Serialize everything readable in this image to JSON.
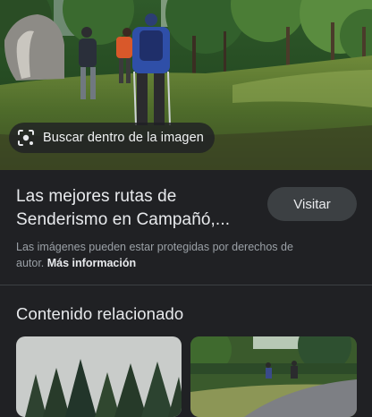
{
  "hero": {
    "image_alt": "Senderistas caminando por un prado junto a un bosque de pinos",
    "lens_chip_label": "Buscar dentro de la imagen",
    "lens_icon": "lens-scan-icon"
  },
  "result": {
    "title": "Las mejores rutas de Senderismo en Campañó,...",
    "visit_label": "Visitar",
    "disclaimer": "Las imágenes pueden estar protegidas por derechos de autor.",
    "more_info_label": "Más información"
  },
  "related": {
    "heading": "Contenido relacionado",
    "thumbnails": [
      {
        "alt": "Bosque de pinos bajo cielo gris"
      },
      {
        "alt": "Senderistas en un camino de bosque"
      }
    ]
  },
  "colors": {
    "background": "#202124",
    "chip": "#3c4043",
    "text_primary": "#e8eaed",
    "text_secondary": "#9aa0a6"
  }
}
